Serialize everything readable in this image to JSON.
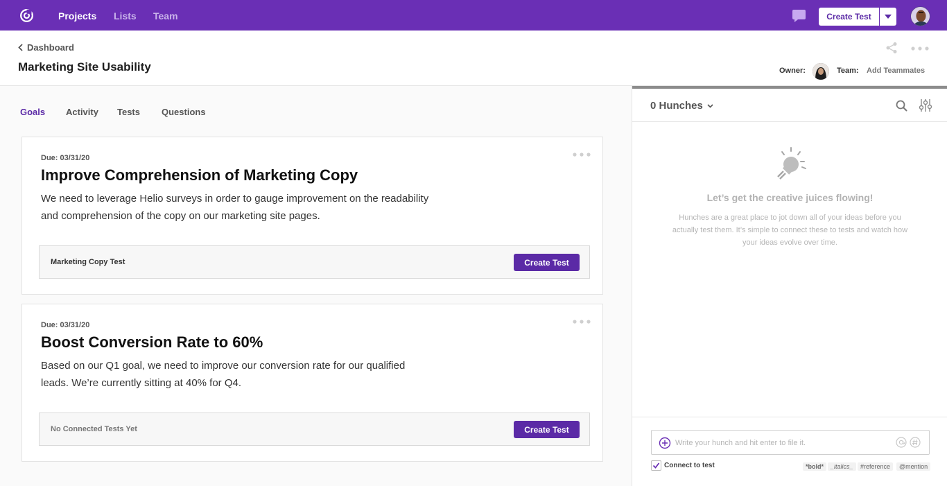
{
  "nav": {
    "links": [
      "Projects",
      "Lists",
      "Team"
    ],
    "create_test_label": "Create Test"
  },
  "header": {
    "back_label": "Dashboard",
    "title": "Marketing Site Usability",
    "owner_label": "Owner:",
    "team_label": "Team:",
    "add_teammates": "Add Teammates"
  },
  "tabs": [
    "Goals",
    "Activity",
    "Tests",
    "Questions"
  ],
  "goals": [
    {
      "due": "Due: 03/31/20",
      "title": "Improve Comprehension of Marketing Copy",
      "description": "We need to leverage Helio surveys in order to gauge improvement on the readability and comprehension of the copy on our marketing site pages.",
      "test_label": "Marketing Copy Test",
      "button": "Create Test"
    },
    {
      "due": "Due: 03/31/20",
      "title": "Boost Conversion Rate to 60%",
      "description": "Based on our Q1 goal, we need to improve our conversion rate for our qualified leads. We’re currently sitting at 40% for Q4.",
      "test_label": "No Connected Tests Yet",
      "button": "Create Test"
    }
  ],
  "hunches": {
    "count_label": "0 Hunches",
    "empty_title": "Let’s get the creative juices flowing!",
    "empty_desc": "Hunches are a great place to jot down all of your ideas before you actually test them. It’s simple to connect these to tests and watch how your ideas evolve over time.",
    "input_placeholder": "Write your hunch and hit enter to file it.",
    "connect_label": "Connect to test",
    "connect_checked": true,
    "format_hints": [
      "*bold*",
      "_italics_",
      "#reference",
      "@mention"
    ]
  },
  "colors": {
    "brand": "#6a2fb5",
    "button": "#5b2aa6"
  }
}
